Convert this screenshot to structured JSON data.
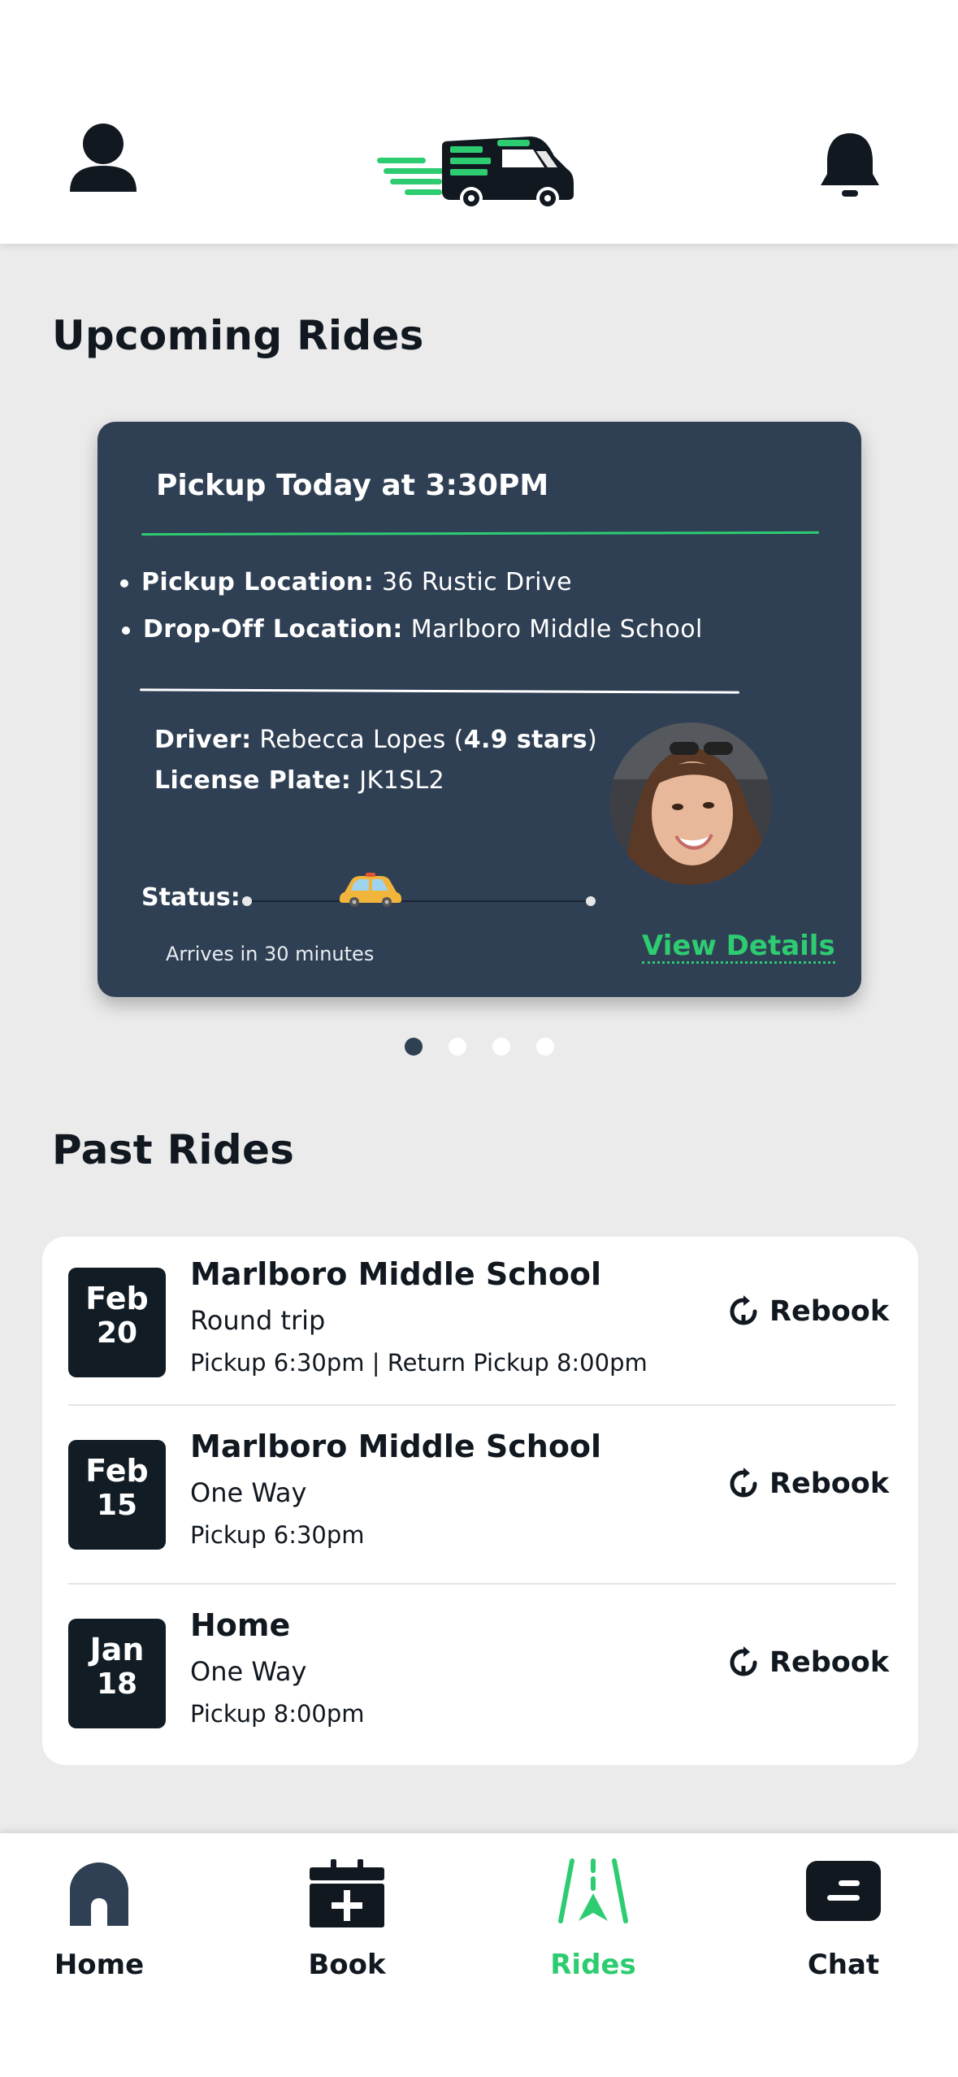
{
  "header": {
    "profile_icon": "person-icon",
    "logo": "van-logo",
    "bell_icon": "bell-icon"
  },
  "upcoming": {
    "title": "Upcoming Rides",
    "card": {
      "pickup_title": "Pickup Today at 3:30PM",
      "pickup_label": "Pickup Location:",
      "pickup_value": "36 Rustic Drive",
      "dropoff_label": "Drop-Off Location:",
      "dropoff_value": "Marlboro Middle School",
      "driver_label": "Driver:",
      "driver_name": "Rebecca Lopes (",
      "driver_rating": "4.9 stars",
      "driver_close": ")",
      "plate_label": "License Plate:",
      "plate_value": "JK1SL2",
      "status_label": "Status:",
      "status_progress": 0.36,
      "arrives": "Arrives in 30 minutes",
      "view_details": "View Details"
    },
    "pager": {
      "count": 4,
      "active": 0
    }
  },
  "past": {
    "title": "Past Rides",
    "rebook_label": "Rebook",
    "rides": [
      {
        "month": "Feb",
        "day": "20",
        "dest": "Marlboro Middle School",
        "type": "Round trip",
        "times": "Pickup 6:30pm | Return Pickup 8:00pm"
      },
      {
        "month": "Feb",
        "day": "15",
        "dest": "Marlboro Middle School",
        "type": "One Way",
        "times": "Pickup 6:30pm"
      },
      {
        "month": "Jan",
        "day": "18",
        "dest": "Home",
        "type": "One Way",
        "times": "Pickup 8:00pm"
      }
    ]
  },
  "nav": {
    "home": "Home",
    "book": "Book",
    "rides": "Rides",
    "chat": "Chat",
    "active": "rides"
  },
  "colors": {
    "accent": "#2ecc71",
    "card": "#2f4054",
    "dark": "#111c24",
    "background": "#ebebeb"
  }
}
